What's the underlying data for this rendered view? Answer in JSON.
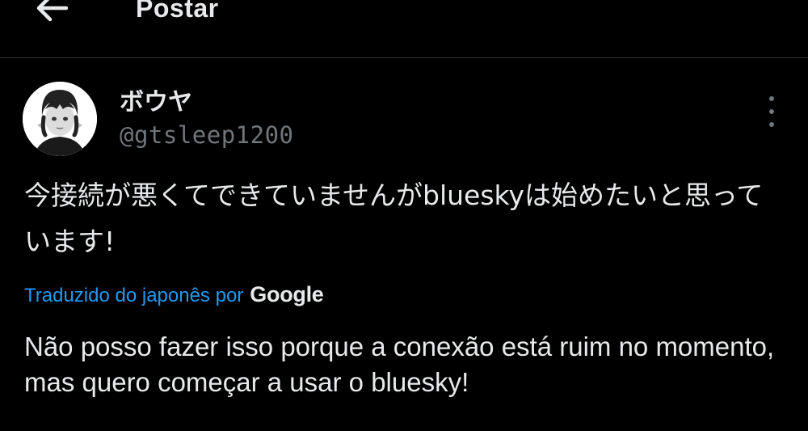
{
  "header": {
    "title": "Postar",
    "back_icon": "arrow-left-icon"
  },
  "post": {
    "author": {
      "display_name": "ボウヤ",
      "handle": "@gtsleep1200",
      "avatar_icon": "avatar-illustration"
    },
    "more_icon": "more-vertical-icon",
    "text": "今接続が悪くてできていませんがblueskyは始めたいと思っています!",
    "translation": {
      "label": "Traduzido do japonês por",
      "provider": "Google",
      "text": "Não posso fazer isso porque a conexão está ruim no momento, mas quero começar a usar o bluesky!"
    }
  },
  "colors": {
    "background": "#000000",
    "text": "#e7e9ea",
    "muted": "#71767b",
    "accent": "#1d9bf0",
    "divider": "#2f3336"
  }
}
